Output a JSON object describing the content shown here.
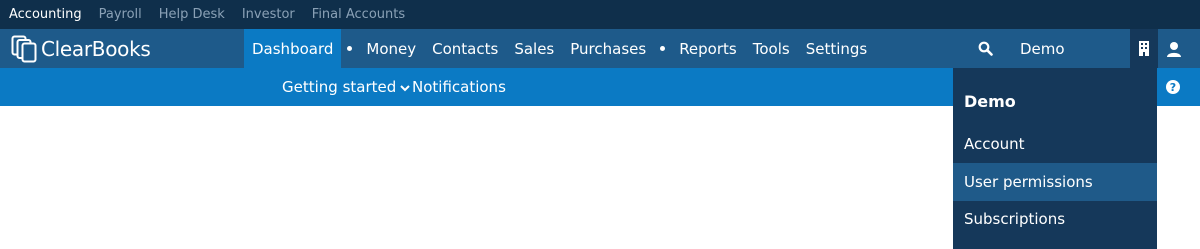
{
  "top_bar": {
    "products": [
      "Accounting",
      "Payroll",
      "Help Desk",
      "Investor",
      "Final Accounts"
    ],
    "active": "Accounting"
  },
  "main_nav": {
    "logo_text": "ClearBooks",
    "items": [
      "Dashboard",
      "Money",
      "Contacts",
      "Sales",
      "Purchases",
      "Reports",
      "Tools",
      "Settings"
    ],
    "active": "Dashboard",
    "account_label": "Demo",
    "search_icon": "search-icon",
    "building_icon": "building-icon",
    "user_icon": "user-icon"
  },
  "sub_nav": {
    "getting_started": "Getting started",
    "notifications": "Notifications",
    "help_icon": "?"
  },
  "account_menu": {
    "title": "Demo",
    "items": [
      "Account",
      "User permissions",
      "Subscriptions"
    ],
    "highlighted": "User permissions"
  },
  "colors": {
    "top_bar_bg": "#0f2f4b",
    "main_nav_bg": "#1e5a8a",
    "accent_blue": "#0b7ac4",
    "dropdown_bg": "#15385a",
    "dropdown_hover": "#1f5a89"
  }
}
